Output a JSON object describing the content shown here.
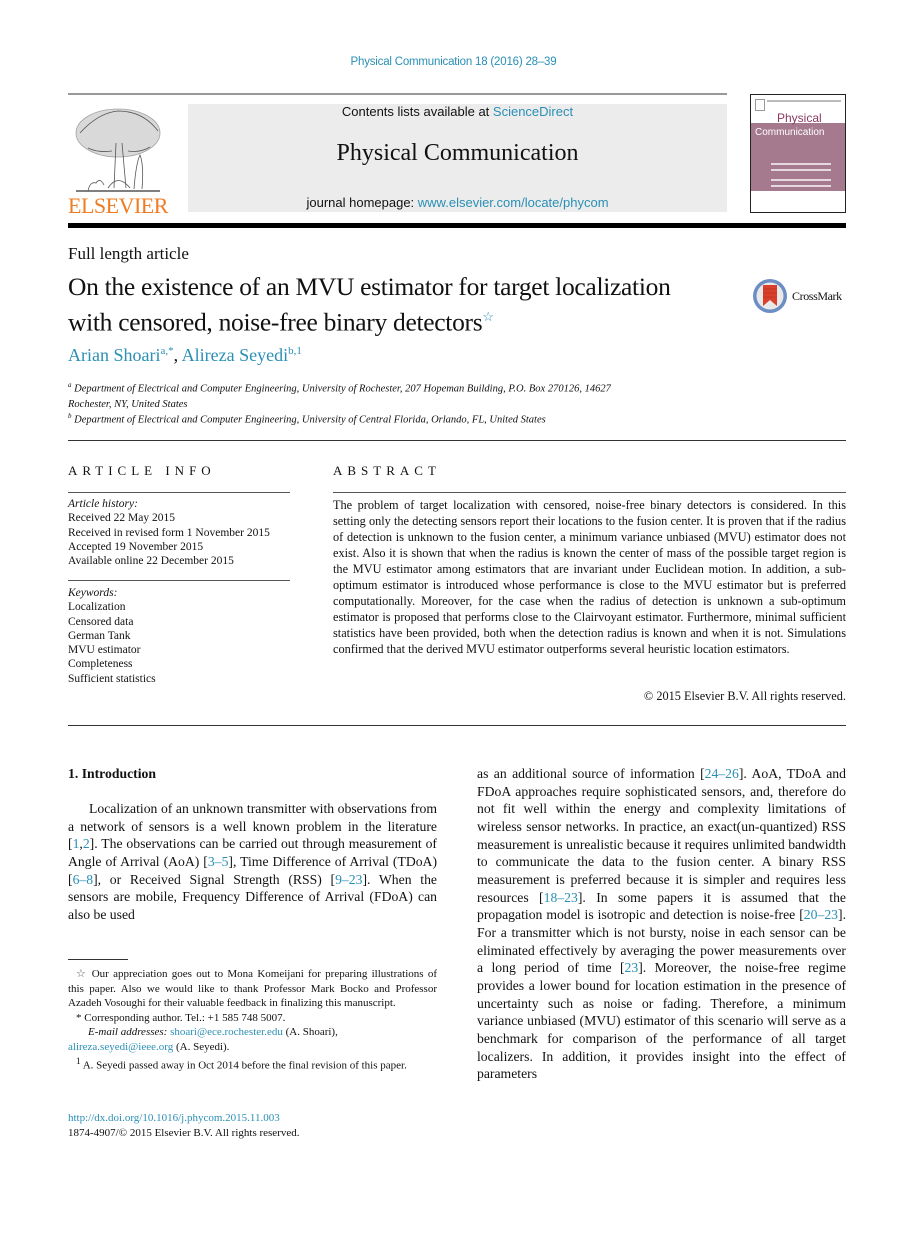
{
  "header": {
    "citation": "Physical Communication 18 (2016) 28–39",
    "contents_prefix": "Contents lists available at ",
    "contents_link": "ScienceDirect",
    "journal_name": "Physical Communication",
    "homepage_prefix": "journal homepage: ",
    "homepage_link": "www.elsevier.com/locate/phycom",
    "publisher_logo_text": "ELSEVIER",
    "cover_title_line1": "Physical",
    "cover_title_line2": "Communication",
    "crossmark_label": "CrossMark"
  },
  "article": {
    "type": "Full length article",
    "title_line1": "On the existence of an MVU estimator for target localization",
    "title_line2": "with censored, noise-free binary detectors",
    "title_mark": "☆",
    "authors": [
      {
        "name": "Arian Shoari",
        "marks": "a,*"
      },
      {
        "name": "Alireza Seyedi",
        "marks": "b,1"
      }
    ],
    "author_separator": ", ",
    "affiliations": [
      {
        "mark": "a",
        "text": "Department of Electrical and Computer Engineering, University of Rochester, 207 Hopeman Building, P.O. Box 270126, 14627",
        "text2": "Rochester, NY, United States"
      },
      {
        "mark": "b",
        "text": "Department of Electrical and Computer Engineering, University of Central Florida, Orlando, FL, United States"
      }
    ]
  },
  "article_info": {
    "heading": "ARTICLE INFO",
    "history_label": "Article history:",
    "history": [
      "Received 22 May 2015",
      "Received in revised form 1 November 2015",
      "Accepted 19 November 2015",
      "Available online 22 December 2015"
    ],
    "keywords_label": "Keywords:",
    "keywords": [
      "Localization",
      "Censored data",
      "German Tank",
      "MVU estimator",
      "Completeness",
      "Sufficient statistics"
    ]
  },
  "abstract": {
    "heading": "ABSTRACT",
    "text": "The problem of target localization with censored, noise-free binary detectors is considered. In this setting only the detecting sensors report their locations to the fusion center. It is proven that if the radius of detection is unknown to the fusion center, a minimum variance unbiased (MVU) estimator does not exist. Also it is shown that when the radius is known the center of mass of the possible target region is the MVU estimator among estimators that are invariant under Euclidean motion. In addition, a sub-optimum estimator is introduced whose performance is close to the MVU estimator but is preferred computationally. Moreover, for the case when the radius of detection is unknown a sub-optimum estimator is proposed that performs close to the Clairvoyant estimator. Furthermore, minimal sufficient statistics have been provided, both when the detection radius is known and when it is not. Simulations confirmed that the derived MVU estimator outperforms several heuristic location estimators.",
    "copyright": "© 2015 Elsevier B.V. All rights reserved."
  },
  "body": {
    "section_heading": "1.  Introduction",
    "left_column": [
      {
        "t": "Localization of an unknown transmitter with observations from a network of sensors is a well known problem in the literature "
      },
      {
        "t": "[",
        "c": false
      },
      {
        "t": "1",
        "c": true
      },
      {
        "t": ",",
        "c": false
      },
      {
        "t": "2",
        "c": true
      },
      {
        "t": "]. The observations can be carried out through measurement of Angle of Arrival (AoA) ["
      },
      {
        "t": "3–5",
        "c": true
      },
      {
        "t": "], Time Difference of Arrival (TDoA) ["
      },
      {
        "t": "6–8",
        "c": true
      },
      {
        "t": "], or Received Signal Strength (RSS) ["
      },
      {
        "t": "9–23",
        "c": true
      },
      {
        "t": "]. When the sensors are mobile, Frequency Difference of Arrival (FDoA) can also be used"
      }
    ],
    "right_column": [
      {
        "t": "as an additional source of information ["
      },
      {
        "t": "24–26",
        "c": true
      },
      {
        "t": "]. AoA, TDoA and FDoA approaches require sophisticated sensors, and, therefore do not fit well within the energy and complexity limitations of wireless sensor networks. In practice, an exact(un-quantized) RSS measurement is unrealistic because it requires unlimited bandwidth to communicate the data to the fusion center. A binary RSS measurement is preferred because it is simpler and requires less resources ["
      },
      {
        "t": "18–23",
        "c": true
      },
      {
        "t": "]. In some papers it is assumed that the propagation model is isotropic and detection is noise-free ["
      },
      {
        "t": "20–23",
        "c": true
      },
      {
        "t": "]. For a transmitter which is not bursty, noise in each sensor can be eliminated effectively by averaging the power measurements over a long period of time ["
      },
      {
        "t": "23",
        "c": true
      },
      {
        "t": "]. Moreover, the noise-free regime provides a lower bound for location estimation in the presence of uncertainty such as noise or fading. Therefore, a minimum variance unbiased (MVU) estimator of this scenario will serve as a benchmark for comparison of the performance of all target localizers. In addition, it provides insight into the effect of parameters"
      }
    ]
  },
  "footnotes": {
    "star_mark": "☆",
    "star_text": "Our appreciation goes out to Mona Komeijani for preparing illustrations of this paper. Also we would like to thank Professor Mark Bocko and Professor Azadeh Vosoughi for their valuable feedback in finalizing this manuscript.",
    "corr_mark": "*",
    "corr_text": "Corresponding author. Tel.: +1 585 748 5007.",
    "email_label": "E-mail addresses:",
    "email1": "shoari@ece.rochester.edu",
    "email1_owner": " (A. Shoari),",
    "email2": "alireza.seyedi@ieee.org",
    "email2_owner": " (A. Seyedi).",
    "note1_mark": "1",
    "note1_text": "A. Seyedi passed away in Oct 2014 before the final revision of this paper.",
    "doi": "http://dx.doi.org/10.1016/j.phycom.2015.11.003",
    "issn": "1874-4907/© 2015 Elsevier B.V. All rights reserved."
  }
}
